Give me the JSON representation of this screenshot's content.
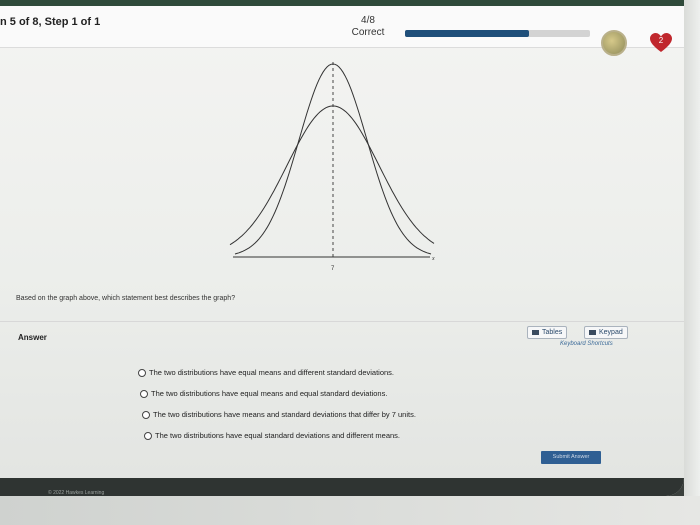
{
  "header": {
    "step_label": "n 5 of 8, Step 1 of 1",
    "score": "4/8",
    "status": "Correct",
    "progress_fraction": 0.67,
    "hearts": "2",
    "coin_icon": "coin-icon",
    "heart_icon": "heart-icon"
  },
  "graph": {
    "mean_label": "7",
    "x_label": "x",
    "curves": [
      "narrow-tall",
      "wide-short"
    ]
  },
  "question": "Based on the graph above, which statement best describes the graph?",
  "answer": {
    "label": "Answer",
    "tables_label": "Tables",
    "keypad_label": "Keypad",
    "shortcuts_label": "Keyboard Shortcuts"
  },
  "options": [
    "The two distributions have equal means and different standard deviations.",
    "The two distributions have equal means and equal standard deviations.",
    "The two distributions have means and standard deviations that differ by 7 units.",
    "The two distributions have equal standard deviations and different means."
  ],
  "submit_label": "Submit Answer",
  "footer": {
    "copyright": "© 2022 Hawkes Learning"
  },
  "colors": {
    "progress": "#1f4f7a",
    "heart": "#c0272d",
    "submit": "#2f5f93"
  }
}
